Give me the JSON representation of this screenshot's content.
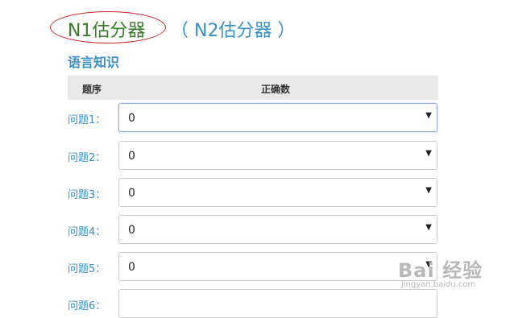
{
  "header": {
    "title_active": "N1估分器",
    "title_other": "（ N2估分器 ）"
  },
  "section": {
    "title": "语言知识"
  },
  "table": {
    "col_question": "题序",
    "col_correct": "正确数"
  },
  "rows": [
    {
      "label": "问题1：",
      "value": "0",
      "caret": "▼"
    },
    {
      "label": "问题2：",
      "value": "0",
      "caret": "▼"
    },
    {
      "label": "问题3：",
      "value": "0",
      "caret": "▼"
    },
    {
      "label": "问题4：",
      "value": "0",
      "caret": "▼"
    },
    {
      "label": "问题5：",
      "value": "0",
      "caret": "▼"
    },
    {
      "label": "问题6：",
      "value": "",
      "caret": ""
    }
  ],
  "watermark": {
    "text": "Bai 经验",
    "sub": "jingyan.baidu.com"
  },
  "colors": {
    "active_title": "#3a7d2c",
    "link_blue": "#3a8fc4",
    "highlight_circle": "#cc2222"
  }
}
